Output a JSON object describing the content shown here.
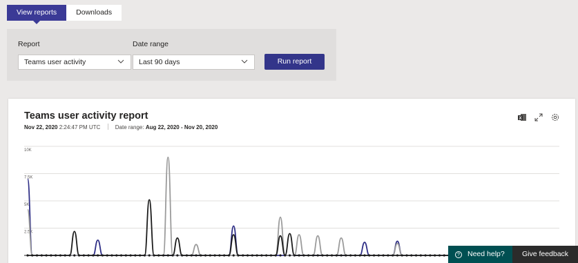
{
  "tabs": [
    {
      "label": "View reports",
      "active": true
    },
    {
      "label": "Downloads",
      "active": false
    }
  ],
  "filters": {
    "report_label": "Report",
    "report_value": "Teams user activity",
    "date_label": "Date range",
    "date_value": "Last 90 days",
    "run_label": "Run report"
  },
  "card": {
    "title": "Teams user activity report",
    "timestamp_date": "Nov 22, 2020",
    "timestamp_time": "2:24:47 PM UTC",
    "date_range_prefix": "Date range:",
    "date_range_value": "Aug 22, 2020 - Nov 20, 2020",
    "icons": [
      "excel-icon",
      "expand-icon",
      "settings-icon"
    ]
  },
  "footer": {
    "need_help": "Need help?",
    "give_feedback": "Give feedback"
  },
  "colors": {
    "accent": "#3b3a96",
    "series_navy": "#2e2e86",
    "series_gray": "#9b9b9b",
    "series_black": "#1b1b1b",
    "help_teal": "#004f52"
  },
  "chart_data": {
    "type": "line",
    "title": "",
    "xlabel": "",
    "ylabel": "",
    "yticks": [
      "10K",
      "7.5K",
      "5K",
      "2.5K"
    ],
    "ylim": [
      0,
      10000
    ],
    "num_points": 91,
    "series": [
      {
        "color": "#2e2e86",
        "peaks": [
          [
            0,
            7000
          ],
          [
            15,
            1400
          ],
          [
            44,
            2700
          ],
          [
            72,
            1200
          ],
          [
            79,
            1300
          ]
        ]
      },
      {
        "color": "#9b9b9b",
        "peaks": [
          [
            0,
            4200
          ],
          [
            30,
            9000
          ],
          [
            36,
            1000
          ],
          [
            54,
            3500
          ],
          [
            58,
            1900
          ],
          [
            62,
            1800
          ],
          [
            67,
            1600
          ],
          [
            79,
            1100
          ]
        ]
      },
      {
        "color": "#1b1b1b",
        "peaks": [
          [
            10,
            2200
          ],
          [
            26,
            5100
          ],
          [
            32,
            1600
          ],
          [
            44,
            1900
          ],
          [
            54,
            1800
          ],
          [
            56,
            2000
          ]
        ]
      }
    ]
  }
}
